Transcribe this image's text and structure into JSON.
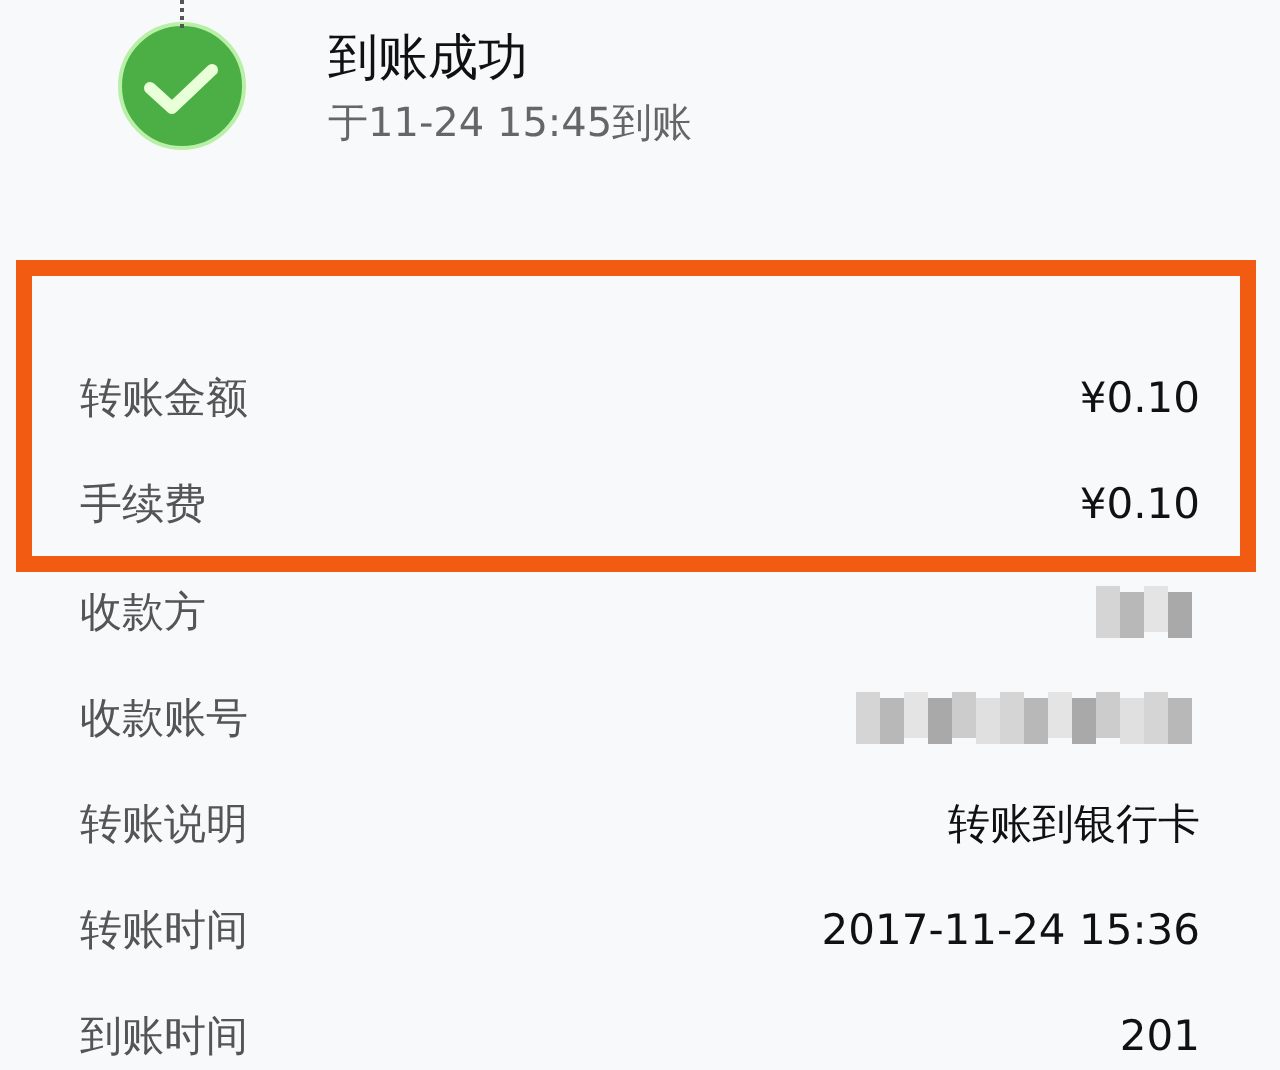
{
  "status": {
    "title": "到账成功",
    "subtitle": "于11-24 15:45到账"
  },
  "highlighted_rows": [
    {
      "label": "转账金额",
      "kind": "text",
      "value": "¥0.10"
    },
    {
      "label": "手续费",
      "kind": "text",
      "value": "¥0.10"
    }
  ],
  "rows": [
    {
      "label": "收款方",
      "kind": "redacted"
    },
    {
      "label": "收款账号",
      "kind": "redacted"
    },
    {
      "label": "转账说明",
      "kind": "text",
      "value": "转账到银行卡"
    },
    {
      "label": "转账时间",
      "kind": "text",
      "value": "2017-11-24 15:36"
    },
    {
      "label": "到账时间",
      "kind": "text",
      "value": "201"
    }
  ]
}
